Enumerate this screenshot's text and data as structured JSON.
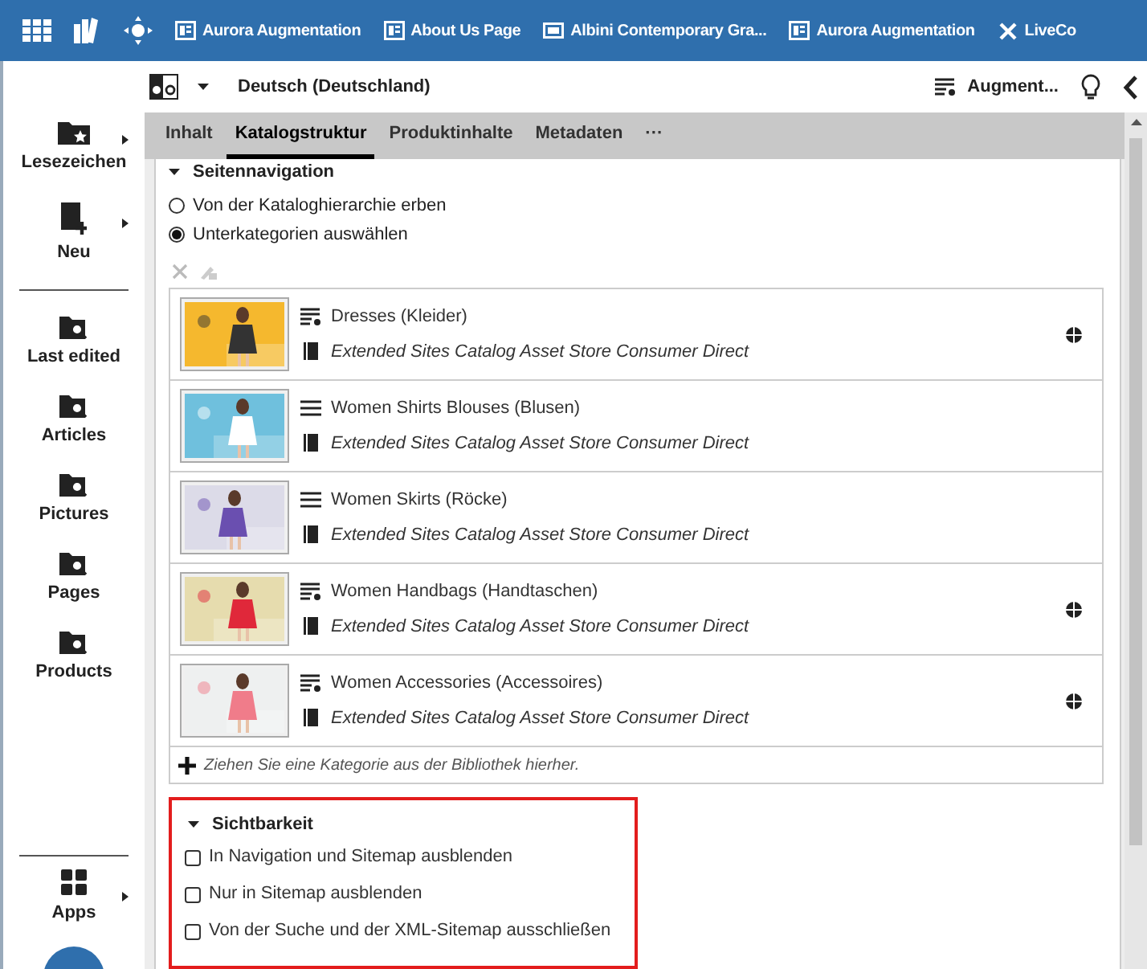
{
  "top_tabs": [
    {
      "kind": "page",
      "label": "Aurora Augmentation"
    },
    {
      "kind": "page",
      "label": "About Us Page"
    },
    {
      "kind": "banner",
      "label": "Albini Contemporary Gra..."
    },
    {
      "kind": "page",
      "label": "Aurora Augmentation"
    },
    {
      "kind": "tool",
      "label": "LiveCo"
    }
  ],
  "sidebar": {
    "items": [
      {
        "label": "Lesezeichen",
        "kind": "bookmarks",
        "submenu": true
      },
      {
        "label": "Neu",
        "kind": "new",
        "submenu": true
      },
      {
        "label": "Last edited",
        "kind": "search",
        "submenu": false
      },
      {
        "label": "Articles",
        "kind": "search",
        "submenu": false
      },
      {
        "label": "Pictures",
        "kind": "search",
        "submenu": false
      },
      {
        "label": "Pages",
        "kind": "search",
        "submenu": false
      },
      {
        "label": "Products",
        "kind": "search",
        "submenu": false
      }
    ],
    "apps": {
      "label": "Apps"
    }
  },
  "toolbar": {
    "locale": "Deutsch (Deutschland)",
    "workflow": "Augment..."
  },
  "tabs": [
    {
      "label": "Inhalt",
      "selected": false
    },
    {
      "label": "Katalogstruktur",
      "selected": true
    },
    {
      "label": "Produktinhalte",
      "selected": false
    },
    {
      "label": "Metadaten",
      "selected": false
    },
    {
      "label": "···",
      "selected": false
    }
  ],
  "navigation": {
    "title": "Seitennavigation",
    "options": [
      {
        "label": "Von der Kataloghierarchie erben",
        "selected": false
      },
      {
        "label": "Unterkategorien auswählen",
        "selected": true
      }
    ],
    "categories": [
      {
        "name": "Dresses (Kleider)",
        "kind": "augmented",
        "store": "Extended Sites Catalog Asset Store Consumer Direct",
        "globe": true
      },
      {
        "name": "Women Shirts Blouses (Blusen)",
        "kind": "plain",
        "store": "Extended Sites Catalog Asset Store Consumer Direct",
        "globe": false
      },
      {
        "name": "Women Skirts (Röcke)",
        "kind": "plain",
        "store": "Extended Sites Catalog Asset Store Consumer Direct",
        "globe": false
      },
      {
        "name": "Women Handbags (Handtaschen)",
        "kind": "augmented",
        "store": "Extended Sites Catalog Asset Store Consumer Direct",
        "globe": true
      },
      {
        "name": "Women Accessories (Accessoires)",
        "kind": "augmented",
        "store": "Extended Sites Catalog Asset Store Consumer Direct",
        "globe": true
      }
    ],
    "drop_hint": "Ziehen Sie eine Kategorie aus der Bibliothek hierher."
  },
  "visibility": {
    "title": "Sichtbarkeit",
    "options": [
      {
        "label": "In Navigation und Sitemap ausblenden",
        "checked": false
      },
      {
        "label": "Nur in Sitemap ausblenden",
        "checked": false
      },
      {
        "label": "Von der Suche und der XML-Sitemap ausschließen",
        "checked": false
      }
    ]
  }
}
